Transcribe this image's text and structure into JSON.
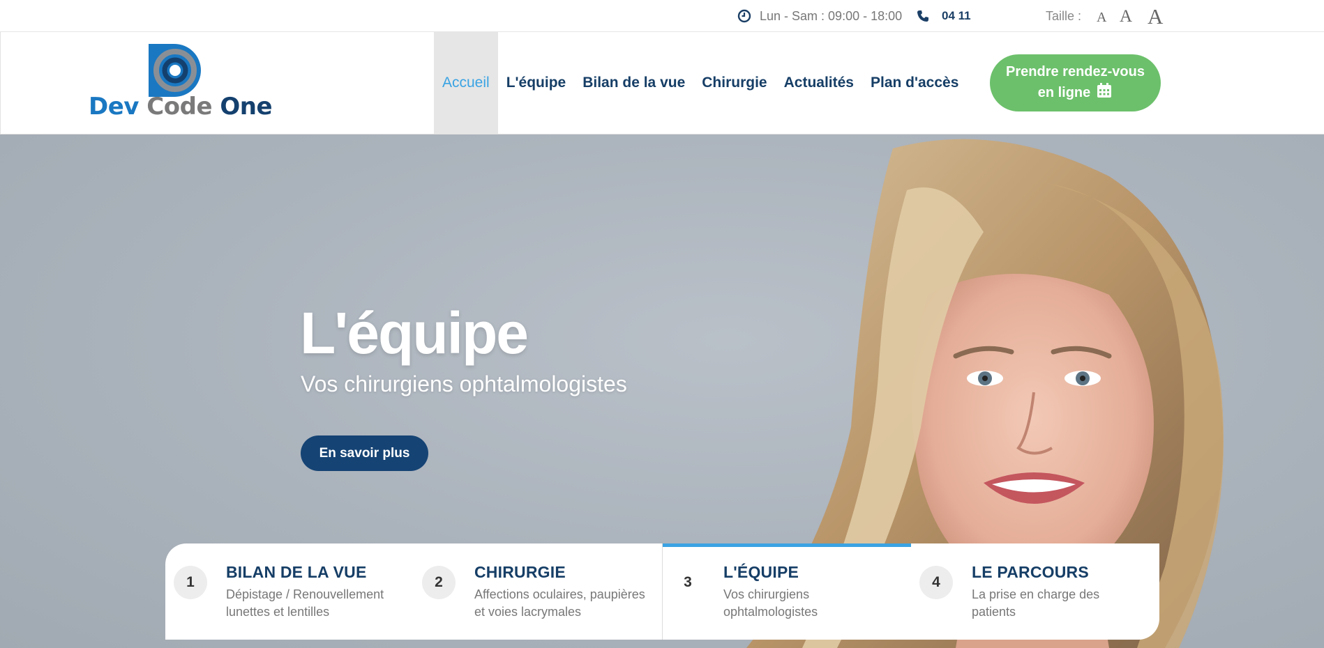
{
  "topbar": {
    "hours": "Lun - Sam : 09:00 - 18:00",
    "phone": "04 11",
    "size_label": "Taille :",
    "size_options": [
      "A",
      "A",
      "A"
    ]
  },
  "logo": {
    "part1": "Dev",
    "part2": "Code",
    "part3": "One"
  },
  "nav": {
    "items": [
      {
        "label": "Accueil",
        "active": true
      },
      {
        "label": "L'équipe"
      },
      {
        "label": "Bilan de la vue"
      },
      {
        "label": "Chirurgie"
      },
      {
        "label": "Actualités"
      },
      {
        "label": "Plan d'accès"
      }
    ]
  },
  "cta": {
    "line1": "Prendre rendez-vous",
    "line2": "en ligne"
  },
  "hero": {
    "title": "L'équipe",
    "subtitle": "Vos chirurgiens ophtalmologistes",
    "button": "En savoir plus"
  },
  "steps": [
    {
      "num": "1",
      "title": "BILAN DE LA VUE",
      "desc": "Dépistage / Renouvellement lunettes et lentilles"
    },
    {
      "num": "2",
      "title": "CHIRURGIE",
      "desc": "Affections oculaires, paupières et voies lacrymales"
    },
    {
      "num": "3",
      "title": "L'ÉQUIPE",
      "desc": "Vos chirurgiens ophtalmologistes",
      "active": true
    },
    {
      "num": "4",
      "title": "LE PARCOURS",
      "desc": "La prise en charge des patients"
    }
  ],
  "colors": {
    "brand_dark": "#163e66",
    "accent_blue": "#3aa3e3",
    "cta_green": "#6cc06b",
    "hero_button": "#154374"
  }
}
